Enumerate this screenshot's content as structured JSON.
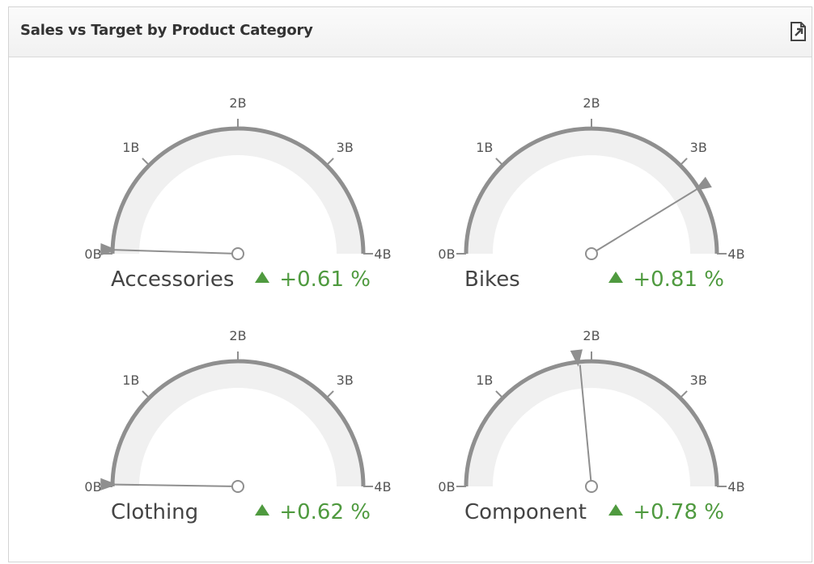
{
  "panel": {
    "title": "Sales vs Target by Product Category"
  },
  "toolbar": {
    "export_icon": "export-document-icon"
  },
  "colors": {
    "scale": "#8f8f8f",
    "band": "#f0f0f0",
    "needle": "#8f8f8f",
    "marker": "#8f8f8f",
    "tick_text": "#555555",
    "label_text": "#444444",
    "delta_positive": "#4f9a3f"
  },
  "chart_data": {
    "type": "gauge",
    "scale": {
      "min": 0,
      "max": 4,
      "unit": "B",
      "ticks": [
        "0B",
        "1B",
        "2B",
        "3B",
        "4B"
      ]
    },
    "gauges": [
      {
        "name": "Accessories",
        "actual": 0.04,
        "target": 0.04,
        "delta": "+0.61 %",
        "delta_direction": "up"
      },
      {
        "name": "Bikes",
        "actual": 3.3,
        "target": 3.3,
        "delta": "+0.81 %",
        "delta_direction": "up"
      },
      {
        "name": "Clothing",
        "actual": 0.02,
        "target": 0.02,
        "delta": "+0.62 %",
        "delta_direction": "up"
      },
      {
        "name": "Component",
        "actual": 1.88,
        "target": 1.86,
        "delta": "+0.78 %",
        "delta_direction": "up"
      }
    ]
  }
}
